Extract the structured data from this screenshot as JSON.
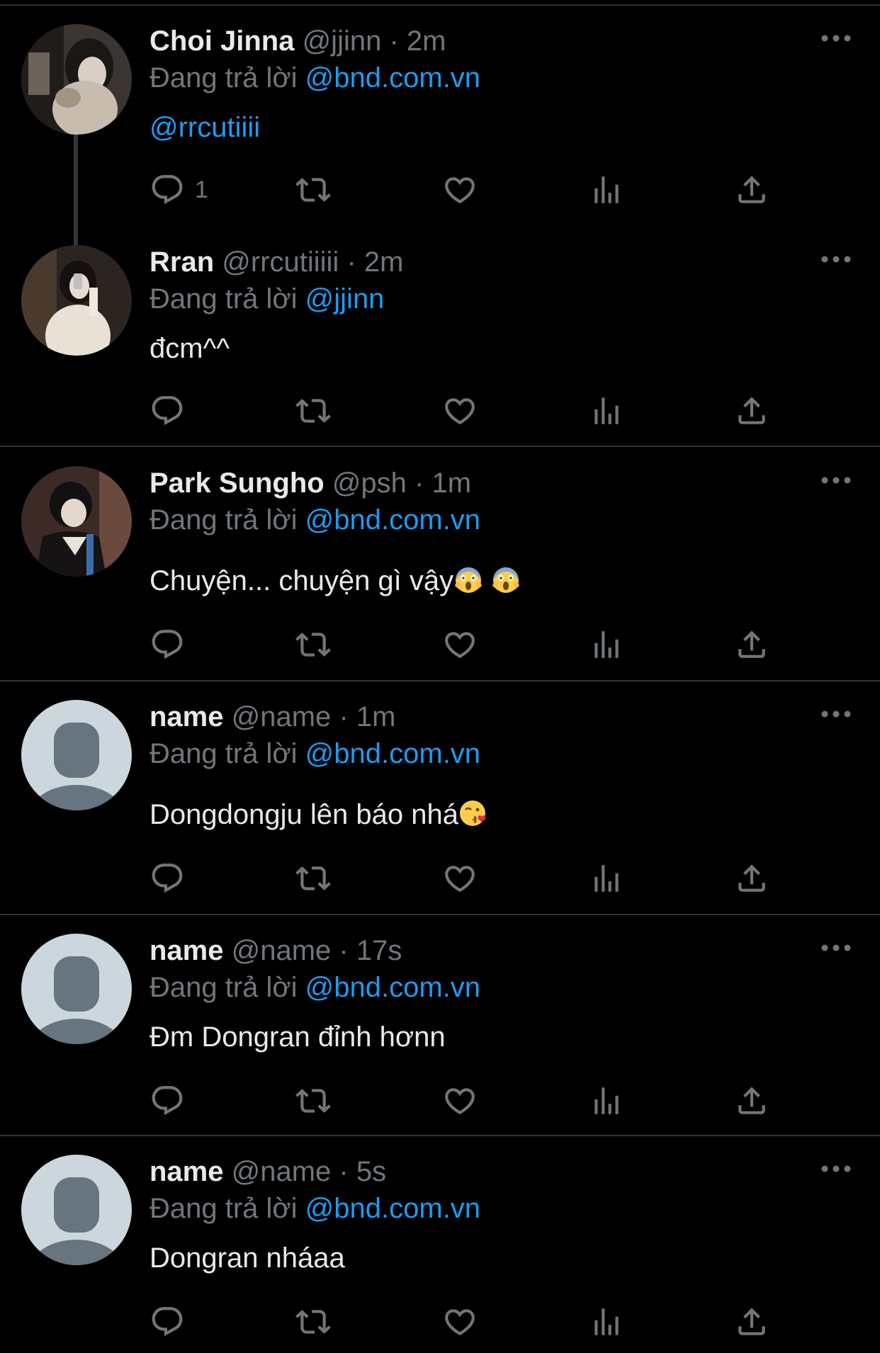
{
  "colors": {
    "background": "#000000",
    "text_primary": "#e7e9ea",
    "text_secondary": "#71767b",
    "accent": "#1d9bf0",
    "divider": "#2f3336",
    "default_avatar_bg": "#ccd6dd",
    "default_avatar_fg": "#66757f"
  },
  "reply_prefix": "Đang trả lời",
  "dot": "·",
  "tweets": [
    {
      "name": "Choi Jinna",
      "handle": "@jjinn",
      "time": "2m",
      "reply_to": "@bnd.com.vn",
      "text": "@rrcutiiii",
      "reply_count": "1",
      "avatar": "photo-avatar"
    },
    {
      "name": "Rran",
      "handle": "@rrcutiiiii",
      "time": "2m",
      "reply_to": "@jjinn",
      "text": "đcm^^",
      "reply_count": "",
      "avatar": "photo-avatar"
    },
    {
      "name": "Park Sungho",
      "handle": "@psh",
      "time": "1m",
      "reply_to": "@bnd.com.vn",
      "text": "Chuyện... chuyện gì vậy",
      "emojis": [
        "screaming-face-emoji",
        "screaming-face-emoji"
      ],
      "reply_count": "",
      "avatar": "photo-avatar"
    },
    {
      "name": "name",
      "handle": "@name",
      "time": "1m",
      "reply_to": "@bnd.com.vn",
      "text": "Dongdongju lên báo nhá",
      "emojis": [
        "kissing-face-emoji"
      ],
      "reply_count": "",
      "avatar": "default-avatar"
    },
    {
      "name": "name",
      "handle": "@name",
      "time": "17s",
      "reply_to": "@bnd.com.vn",
      "text": "Đm Dongran đỉnh hơnn",
      "reply_count": "",
      "avatar": "default-avatar"
    },
    {
      "name": "name",
      "handle": "@name",
      "time": "5s",
      "reply_to": "@bnd.com.vn",
      "text": "Dongran nháaa",
      "reply_count": "",
      "avatar": "default-avatar"
    }
  ]
}
